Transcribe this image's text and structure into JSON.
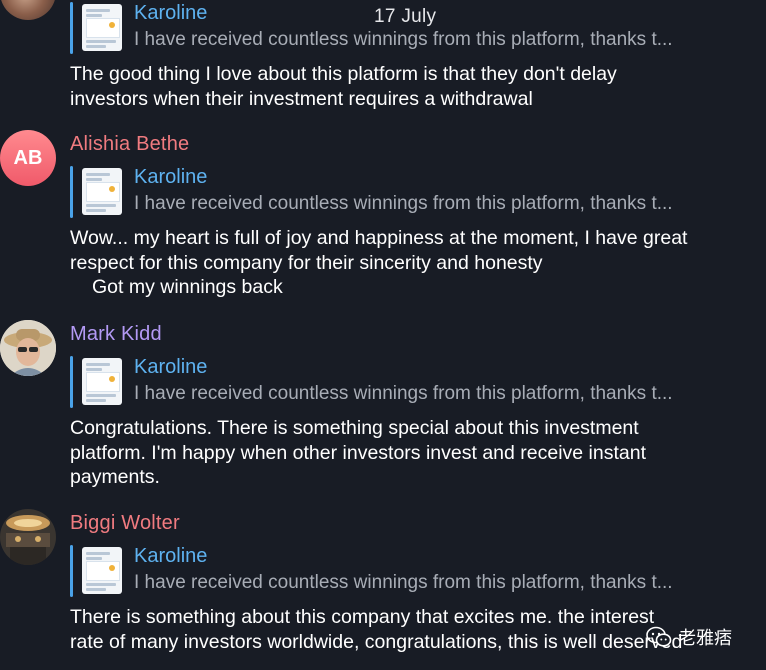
{
  "date_label": "17 July",
  "reply_preview": {
    "name": "Karoline",
    "text": "I have received countless winnings from this platform, thanks t..."
  },
  "messages": [
    {
      "sender": "",
      "sender_color": "#5eb2f0",
      "body": [
        "The good thing I love about this platform is that they don't delay",
        "investors when their investment requires a withdrawal"
      ]
    },
    {
      "sender": "Alishia Bethe",
      "sender_color": "#f07b80",
      "avatar_initials": "AB",
      "body": [
        "Wow... my heart is full of joy and happiness at the moment, I have great",
        "respect for this company for their sincerity and honesty",
        "Got my winnings back"
      ]
    },
    {
      "sender": "Mark Kidd",
      "sender_color": "#b39af5",
      "body": [
        "Congratulations.  There is something special about this investment",
        "platform.  I'm happy when other investors invest and receive instant",
        "payments."
      ]
    },
    {
      "sender": "Biggi Wolter",
      "sender_color": "#f07b80",
      "body": [
        "There is something about this company that excites me.  the interest",
        "rate of many investors worldwide, congratulations, this is well deserved"
      ]
    }
  ],
  "watermark": {
    "text": "老雅痞",
    "icon": "wechat-icon"
  }
}
